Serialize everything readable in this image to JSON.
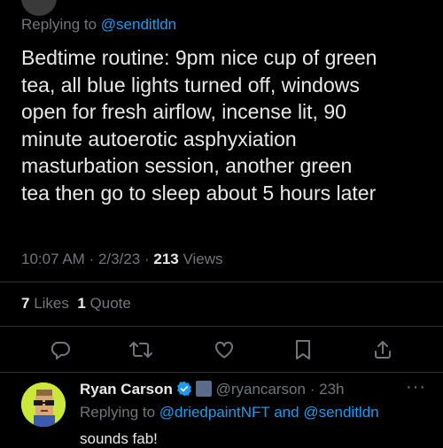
{
  "main_tweet": {
    "replying_prefix": "Replying to",
    "replying_to": "@senditldn",
    "text_lines": [
      "Bedtime routine: 9pm nice cup of green",
      "tea, all blue lights turned off, windows",
      "open for fresh airflow, incense lit, 90",
      "minute autoerotic asphyxiation",
      "masturbation session, another green",
      "tea then go to sleep about 5 hours later"
    ],
    "time": "10:07 AM",
    "date": "2/3/23",
    "separator": "·",
    "views_count": "213",
    "views_label": "Views",
    "likes_count": "7",
    "likes_label": "Likes",
    "quotes_count": "1",
    "quotes_label": "Quote"
  },
  "actions": {
    "reply": "reply-icon",
    "retweet": "retweet-icon",
    "like": "heart-icon",
    "bookmark": "bookmark-icon",
    "share": "share-icon"
  },
  "reply_tweet": {
    "name": "Ryan Carson",
    "handle": "@ryancarson",
    "separator": "·",
    "time": "23h",
    "more": "···",
    "replying_prefix": "Replying to",
    "replying_to_1": "@driedpaintNFT",
    "replying_and": "and",
    "replying_to_2": "@senditldn",
    "text": "sounds fab!"
  },
  "colors": {
    "background": "#000000",
    "text": "#e7e9ea",
    "muted": "#71767b",
    "link": "#1d9bf0",
    "divider": "#2f3336"
  }
}
